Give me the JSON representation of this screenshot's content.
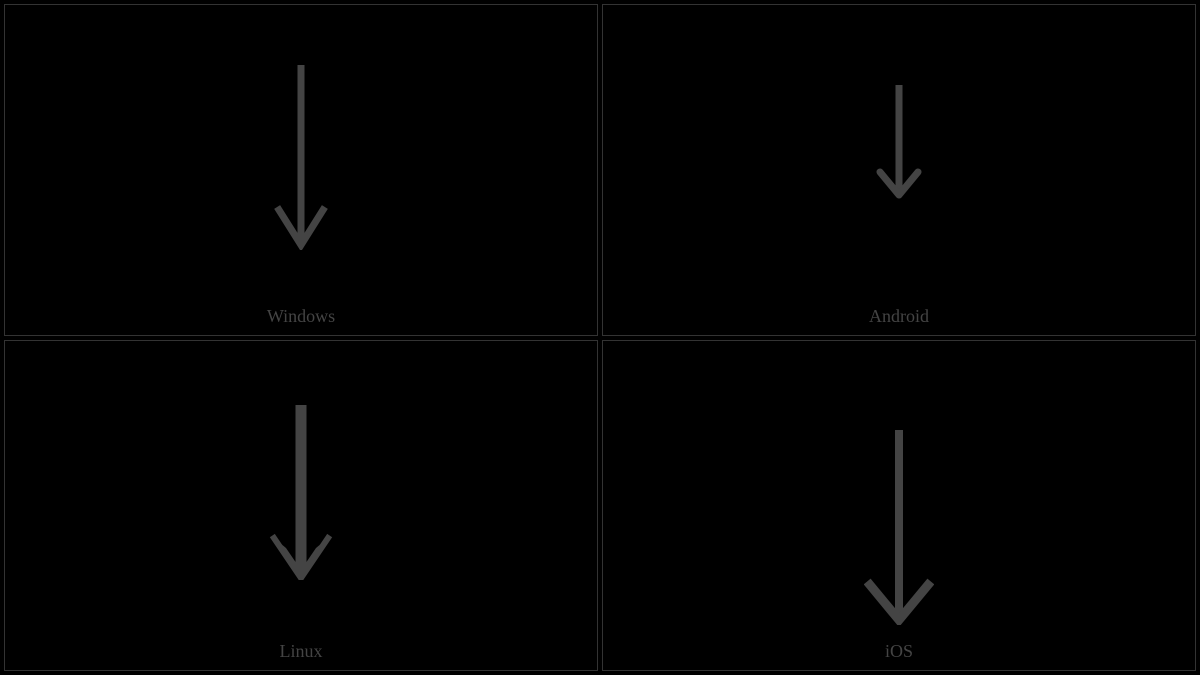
{
  "cells": [
    {
      "label": "Windows",
      "icon": "down-arrow-icon"
    },
    {
      "label": "Android",
      "icon": "down-arrow-icon"
    },
    {
      "label": "Linux",
      "icon": "down-arrow-icon"
    },
    {
      "label": "iOS",
      "icon": "down-arrow-icon"
    }
  ]
}
